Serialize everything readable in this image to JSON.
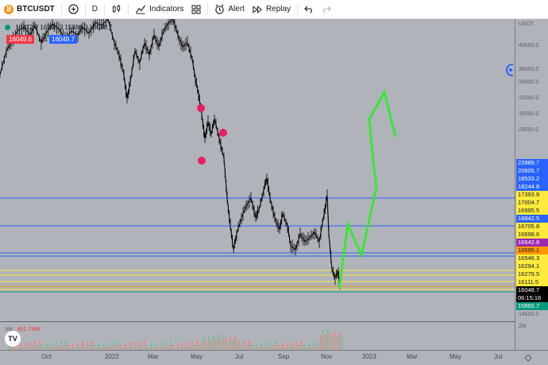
{
  "toolbar": {
    "symbol": "BTCUSDT",
    "coin_glyph": "₿",
    "interval": "D",
    "indicators_label": "Indicators",
    "alert_label": "Alert",
    "replay_label": "Replay"
  },
  "legend": {
    "ohlc": "16272.7   16304.3   15888.0   16048.7",
    "sell_price": "16049.6",
    "spread": "0.1",
    "buy_price": "16049.7",
    "volume_label": "Vol",
    "volume_value": "461.796K"
  },
  "price_axis": {
    "currency": "USDT",
    "labels": [
      "40000.0",
      "36000.0",
      "34000.0",
      "32000.0",
      "30000.0",
      "28000.0",
      "14600.0"
    ],
    "tags": [
      {
        "text": "22889.7",
        "bg": "#2962ff",
        "fg": "#ffffff"
      },
      {
        "text": "20605.7",
        "bg": "#2962ff",
        "fg": "#ffffff"
      },
      {
        "text": "18533.2",
        "bg": "#2962ff",
        "fg": "#ffffff"
      },
      {
        "text": "18244.8",
        "bg": "#2962ff",
        "fg": "#ffffff"
      },
      {
        "text": "17393.9",
        "bg": "#ffeb3b",
        "fg": "#131722"
      },
      {
        "text": "17004.7",
        "bg": "#ffeb3b",
        "fg": "#131722"
      },
      {
        "text": "16995.5",
        "bg": "#ffeb3b",
        "fg": "#131722"
      },
      {
        "text": "16842.5",
        "bg": "#2962ff",
        "fg": "#ffffff"
      },
      {
        "text": "16705.8",
        "bg": "#ffeb3b",
        "fg": "#131722"
      },
      {
        "text": "16698.6",
        "bg": "#ffeb3b",
        "fg": "#131722"
      },
      {
        "text": "16642.8",
        "bg": "#9c27b0",
        "fg": "#ffffff"
      },
      {
        "text": "16595.1",
        "bg": "#ff9800",
        "fg": "#131722"
      },
      {
        "text": "16546.3",
        "bg": "#ffeb3b",
        "fg": "#131722"
      },
      {
        "text": "16294.1",
        "bg": "#ffeb3b",
        "fg": "#131722"
      },
      {
        "text": "16279.5",
        "bg": "#ffeb3b",
        "fg": "#131722"
      },
      {
        "text": "16111.5",
        "bg": "#ffeb3b",
        "fg": "#131722"
      },
      {
        "text": "16048.7",
        "bg": "#000000",
        "fg": "#ffffff"
      },
      {
        "text": "06:15:16",
        "bg": "#000000",
        "fg": "#ffffff"
      },
      {
        "text": "15892.7",
        "bg": "#089981",
        "fg": "#ffffff"
      }
    ],
    "vol_label": "2M"
  },
  "time_axis": {
    "labels": [
      "Oct",
      "2022",
      "Mar",
      "May",
      "Jul",
      "Sep",
      "Nov",
      "2023",
      "Mar",
      "May",
      "Jul"
    ]
  },
  "colors": {
    "sell": "#f23645",
    "buy": "#2962ff",
    "marker": "#e91e63",
    "arrow": "#39e639",
    "candles": "#000000"
  },
  "logo_text": "TV"
}
